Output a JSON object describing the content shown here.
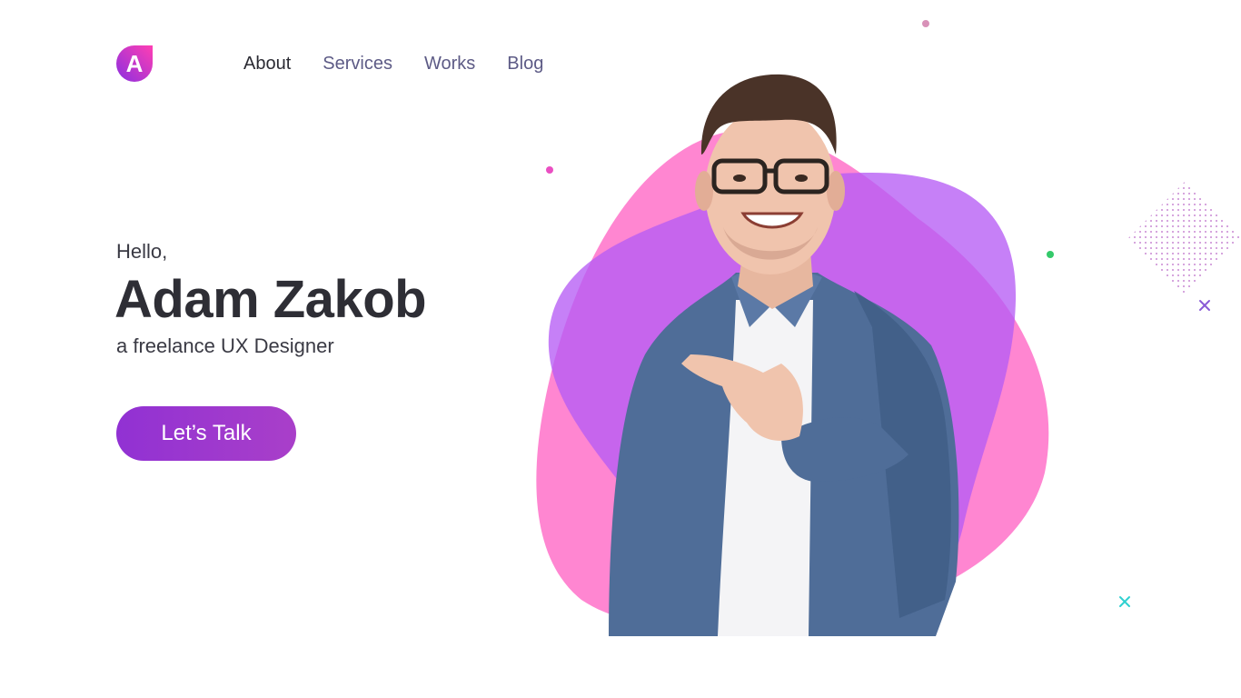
{
  "brand": {
    "logo_letter": "A"
  },
  "nav": {
    "items": [
      {
        "label": "About",
        "active": true
      },
      {
        "label": "Services",
        "active": false
      },
      {
        "label": "Works",
        "active": false
      },
      {
        "label": "Blog",
        "active": false
      }
    ]
  },
  "hero": {
    "greeting": "Hello,",
    "name": "Adam Zakob",
    "role": "a freelance UX Designer",
    "cta_label": "Let’s Talk"
  },
  "colors": {
    "accent": "#9131d3",
    "blob_pink": "#ff7fd0",
    "blob_purple": "#b65cf5",
    "nav_text": "#5d5b86"
  }
}
